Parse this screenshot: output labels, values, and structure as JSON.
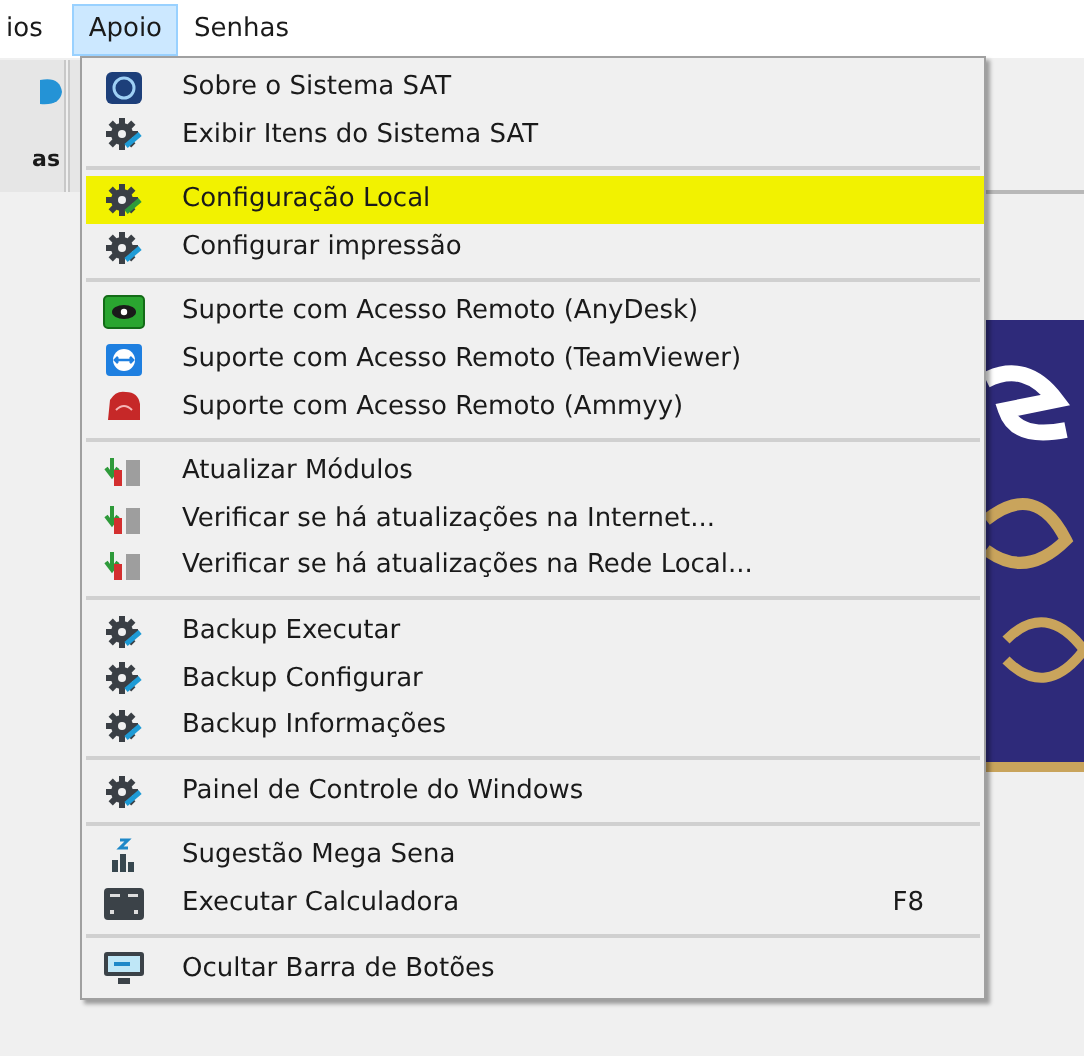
{
  "menubar": [
    {
      "label": "ios",
      "selected": false
    },
    {
      "label": "Apoio",
      "selected": true
    },
    {
      "label": "Senhas",
      "selected": false
    }
  ],
  "toolbar": {
    "button_label": "as"
  },
  "menu": [
    {
      "kind": "item",
      "label": "Sobre o Sistema SAT",
      "highlighted": false
    },
    {
      "kind": "item",
      "label": "Exibir Itens do Sistema SAT",
      "highlighted": false
    },
    {
      "kind": "separator"
    },
    {
      "kind": "item",
      "label": "Configuração Local",
      "highlighted": true
    },
    {
      "kind": "item",
      "label": "Configurar impressão",
      "highlighted": false
    },
    {
      "kind": "separator"
    },
    {
      "kind": "item",
      "label": "Suporte com Acesso Remoto (AnyDesk)",
      "highlighted": false
    },
    {
      "kind": "item",
      "label": "Suporte com Acesso Remoto (TeamViewer)",
      "highlighted": false
    },
    {
      "kind": "item",
      "label": "Suporte com Acesso Remoto (Ammyy)",
      "highlighted": false
    },
    {
      "kind": "separator"
    },
    {
      "kind": "item",
      "label": "Atualizar Módulos",
      "highlighted": false
    },
    {
      "kind": "item",
      "label": "Verificar se há atualizações na Internet...",
      "highlighted": false
    },
    {
      "kind": "item",
      "label": "Verificar se há atualizações na Rede Local...",
      "highlighted": false
    },
    {
      "kind": "separator"
    },
    {
      "kind": "item",
      "label": "Backup Executar",
      "highlighted": false
    },
    {
      "kind": "item",
      "label": "Backup Configurar",
      "highlighted": false
    },
    {
      "kind": "item",
      "label": "Backup Informações",
      "highlighted": false
    },
    {
      "kind": "separator"
    },
    {
      "kind": "item",
      "label": "Painel de Controle do Windows",
      "highlighted": false
    },
    {
      "kind": "separator"
    },
    {
      "kind": "item",
      "label": "Sugestão Mega Sena",
      "highlighted": false
    },
    {
      "kind": "item",
      "label": "Executar Calculadora",
      "shortcut": "F8",
      "highlighted": false
    },
    {
      "kind": "separator"
    },
    {
      "kind": "item",
      "label": "Ocultar Barra de Botões",
      "highlighted": false
    }
  ]
}
